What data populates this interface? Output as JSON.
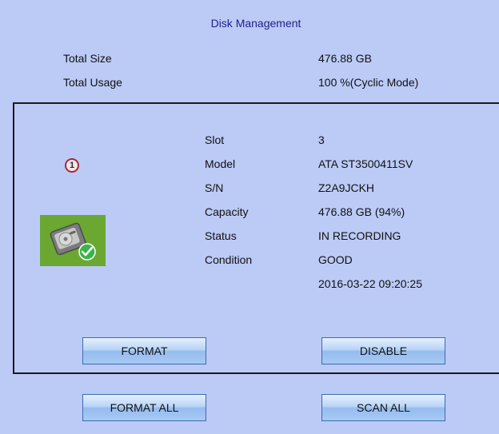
{
  "title": "Disk Management",
  "summary": {
    "total_size_label": "Total Size",
    "total_size_value": "476.88 GB",
    "total_usage_label": "Total Usage",
    "total_usage_value": "100 %(Cyclic Mode)"
  },
  "disk": {
    "number": "1",
    "fields": {
      "slot_label": "Slot",
      "slot_value": "3",
      "model_label": "Model",
      "model_value": "ATA ST3500411SV",
      "sn_label": "S/N",
      "sn_value": "Z2A9JCKH",
      "capacity_label": "Capacity",
      "capacity_value": "476.88 GB (94%)",
      "status_label": "Status",
      "status_value": "IN RECORDING",
      "condition_label": "Condition",
      "condition_value": "GOOD",
      "timestamp": "2016-03-22 09:20:25"
    },
    "format_label": "FORMAT",
    "disable_label": "DISABLE"
  },
  "footer": {
    "format_all_label": "FORMAT ALL",
    "scan_all_label": "SCAN ALL"
  },
  "colors": {
    "background": "#bccaf6",
    "title": "#20228a",
    "disk_tile": "#6aa832",
    "good_check": "#39b54a",
    "badge_border": "#a52a3a"
  },
  "icons": {
    "disk_number": "numbered-circle-icon",
    "disk": "hard-drive-icon",
    "status": "checkmark-icon"
  }
}
